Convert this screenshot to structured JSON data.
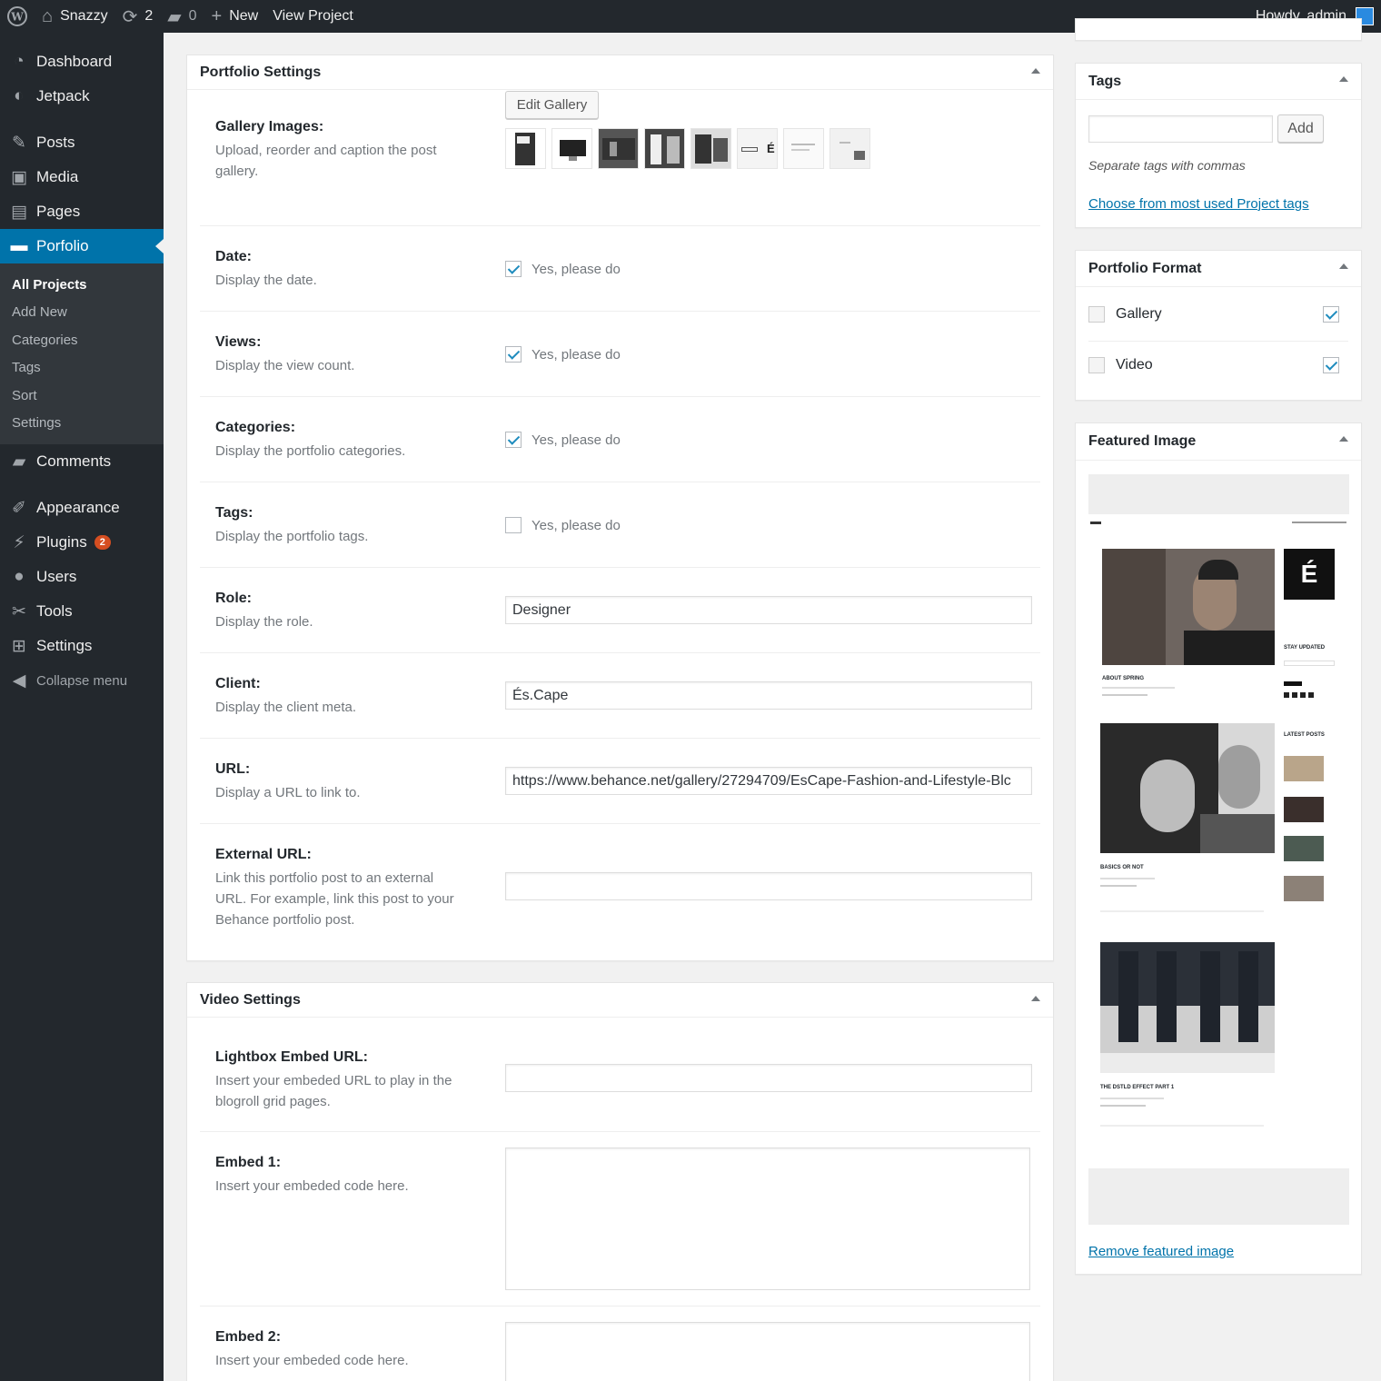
{
  "adminbar": {
    "site_name": "Snazzy",
    "updates_count": "2",
    "comments_count": "0",
    "new_label": "New",
    "view_project": "View Project",
    "greeting": "Howdy, admin"
  },
  "sidebar": {
    "items": [
      {
        "label": "Dashboard"
      },
      {
        "label": "Jetpack"
      },
      {
        "label": "Posts"
      },
      {
        "label": "Media"
      },
      {
        "label": "Pages"
      },
      {
        "label": "Porfolio"
      }
    ],
    "submenu": [
      "All Projects",
      "Add New",
      "Categories",
      "Tags",
      "Sort",
      "Settings"
    ],
    "items2": [
      {
        "label": "Comments"
      },
      {
        "label": "Appearance"
      },
      {
        "label": "Plugins",
        "badge": "2"
      },
      {
        "label": "Users"
      },
      {
        "label": "Tools"
      },
      {
        "label": "Settings"
      }
    ],
    "collapse": "Collapse menu"
  },
  "portfolio_settings": {
    "title": "Portfolio Settings",
    "gallery": {
      "label": "Gallery Images:",
      "desc": "Upload, reorder and caption the post gallery.",
      "button": "Edit Gallery"
    },
    "date": {
      "label": "Date:",
      "desc": "Display the date.",
      "checkbox": "Yes, please do",
      "checked": true
    },
    "views": {
      "label": "Views:",
      "desc": "Display the view count.",
      "checkbox": "Yes, please do",
      "checked": true
    },
    "categories": {
      "label": "Categories:",
      "desc": "Display the portfolio categories.",
      "checkbox": "Yes, please do",
      "checked": true
    },
    "tags": {
      "label": "Tags:",
      "desc": "Display the portfolio tags.",
      "checkbox": "Yes, please do",
      "checked": false
    },
    "role": {
      "label": "Role:",
      "desc": "Display the role.",
      "value": "Designer"
    },
    "client": {
      "label": "Client:",
      "desc": "Display the client meta.",
      "value": "És.Cape"
    },
    "url": {
      "label": "URL:",
      "desc": "Display a URL to link to.",
      "value": "https://www.behance.net/gallery/27294709/EsCape-Fashion-and-Lifestyle-Blc"
    },
    "external_url": {
      "label": "External URL:",
      "desc": "Link this portfolio post to an external URL. For example, link this post to your Behance portfolio post.",
      "value": ""
    }
  },
  "video_settings": {
    "title": "Video Settings",
    "lightbox": {
      "label": "Lightbox Embed URL:",
      "desc": "Insert your embeded URL to play in the blogroll grid pages."
    },
    "embed1": {
      "label": "Embed 1:",
      "desc": "Insert your embeded code here."
    },
    "embed2": {
      "label": "Embed 2:",
      "desc": "Insert your embeded code here."
    }
  },
  "tags_box": {
    "title": "Tags",
    "add_button": "Add",
    "help": "Separate tags with commas",
    "link": "Choose from most used Project tags"
  },
  "format_box": {
    "title": "Portfolio Format",
    "options": [
      {
        "label": "Gallery",
        "checked": true
      },
      {
        "label": "Video",
        "checked": true
      }
    ]
  },
  "featured_box": {
    "title": "Featured Image",
    "remove_link": "Remove featured image",
    "preview": {
      "post1": "ABOUT SPRING",
      "post2": "BASICS OR NOT",
      "post3": "THE DSTLD EFFECT PART 1",
      "stay_updated": "STAY UPDATED",
      "latest_posts": "LATEST POSTS",
      "logo_letter": "É"
    }
  },
  "colors": {
    "accent": "#0073aa",
    "sidebar": "#23282d",
    "badge": "#d54e21"
  }
}
